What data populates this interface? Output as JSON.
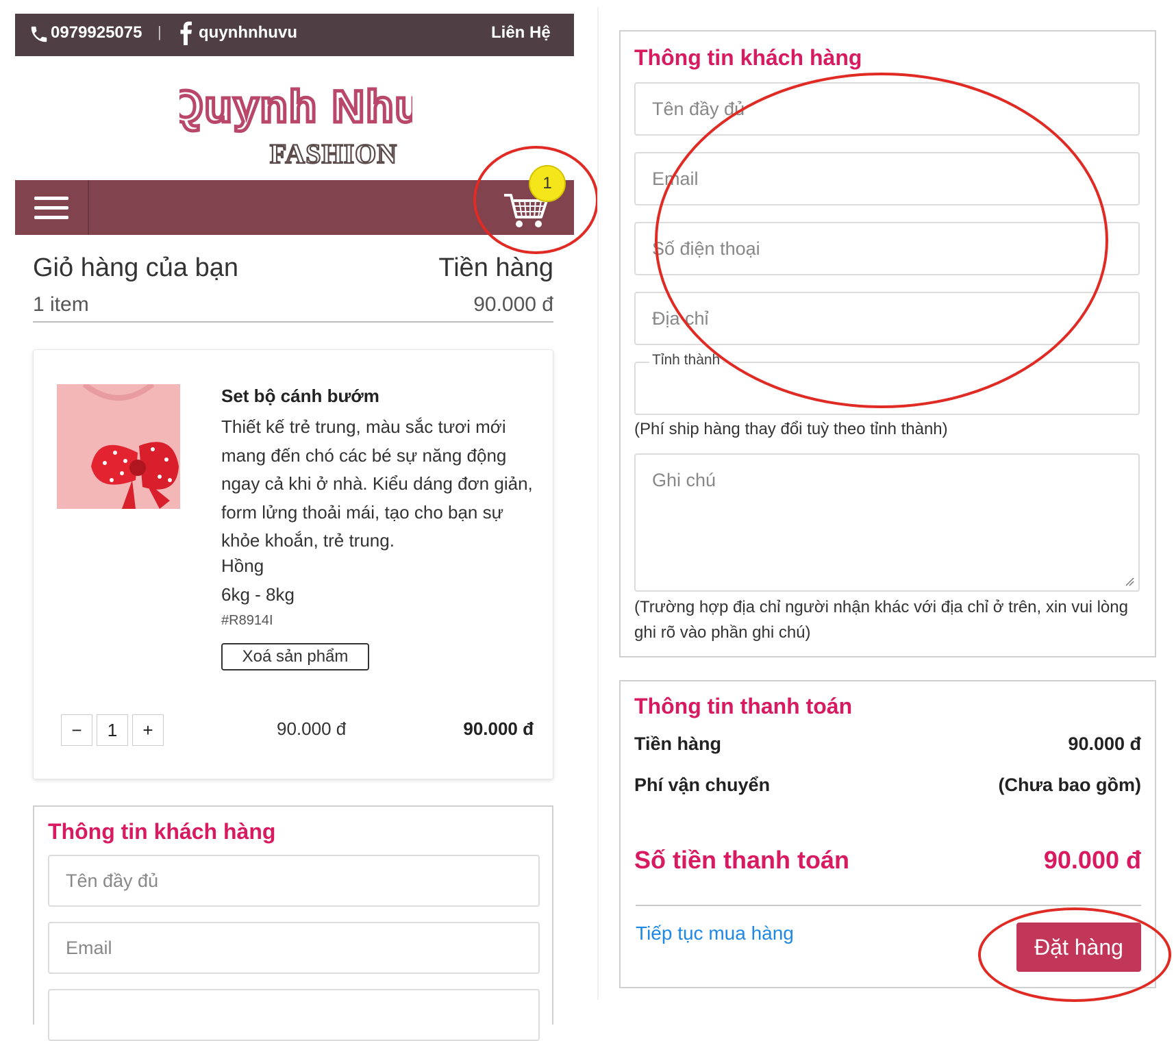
{
  "topbar": {
    "phone": "0979925075",
    "separator": "|",
    "facebook": "quynhnhuvu",
    "contact": "Liên Hệ"
  },
  "logo": {
    "line1": "Quynh Nhu",
    "line2": "FASHION"
  },
  "nav": {
    "menu_icon": "hamburger-menu-icon",
    "cart_icon": "shopping-cart-icon",
    "cart_badge": "1"
  },
  "cart": {
    "title": "Giỏ hàng của bạn",
    "money_title": "Tiền hàng",
    "count": "1 item",
    "total": "90.000 đ"
  },
  "product": {
    "name": "Set bộ cánh bướm",
    "description": "Thiết kế trẻ trung, màu sắc tươi mới mang đến chó các bé sự năng động ngay cả khi ở nhà. Kiểu dáng đơn giản, form lửng thoải mái, tạo cho bạn sự khỏe khoắn, trẻ trung.",
    "color": "Hồng",
    "size": "6kg - 8kg",
    "sku": "#R8914I",
    "remove_label": "Xoá sản phẩm",
    "qty_minus": "−",
    "qty": "1",
    "qty_plus": "+",
    "unit_price": "90.000 đ",
    "line_total": "90.000 đ"
  },
  "customer_form_left": {
    "title": "Thông tin khách hàng",
    "name_placeholder": "Tên đầy đủ",
    "email_placeholder": "Email"
  },
  "customer_form": {
    "title": "Thông tin khách hàng",
    "name_placeholder": "Tên đầy đủ",
    "email_placeholder": "Email",
    "phone_placeholder": "Số điện thoại",
    "address_placeholder": "Địa chỉ",
    "province_label": "Tỉnh thành",
    "province_hint": "(Phí ship hàng thay đổi tuỳ theo tỉnh thành)",
    "note_placeholder": "Ghi chú",
    "note_hint": "(Trường hợp địa chỉ người nhận khác với địa chỉ ở trên, xin vui lòng ghi rõ vào phần ghi chú)"
  },
  "payment": {
    "title": "Thông tin thanh toán",
    "subtotal_label": "Tiền hàng",
    "subtotal_value": "90.000 đ",
    "shipping_label": "Phí vận chuyển",
    "shipping_value": "(Chưa bao gồm)",
    "total_label": "Số tiền thanh toán",
    "total_value": "90.000 đ",
    "continue_label": "Tiếp tục mua hàng",
    "order_label": "Đặt hàng"
  },
  "colors": {
    "topbar": "#4f3f45",
    "navbar": "#81444f",
    "accent": "#d81b60",
    "order_button": "#c2365a",
    "link": "#1e88e5",
    "annotation": "#e02a24",
    "badge": "#f5e51b"
  }
}
